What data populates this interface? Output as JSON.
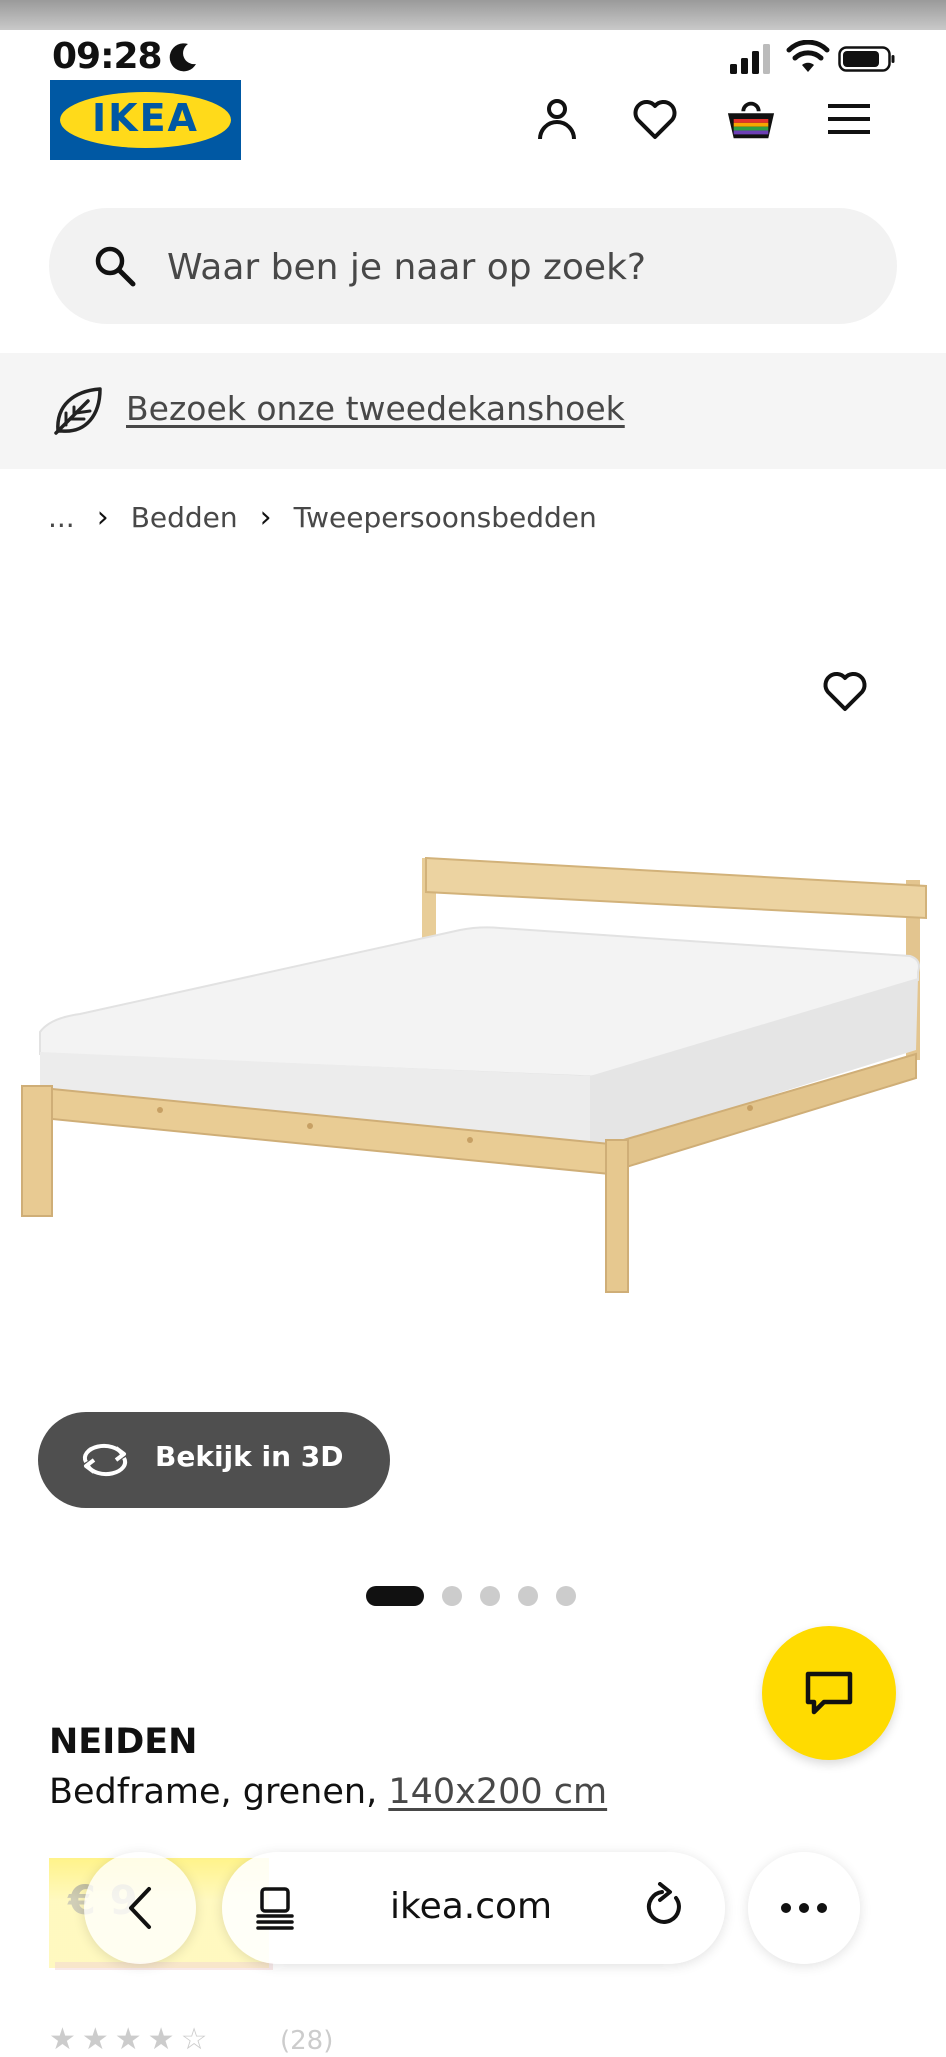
{
  "status_bar": {
    "time": "09:28"
  },
  "header": {
    "logo_text": "IKEA"
  },
  "search": {
    "placeholder": "Waar ben je naar op zoek?"
  },
  "banner": {
    "link_text": "Bezoek onze tweedekanshoek"
  },
  "breadcrumb": {
    "ellipsis": "...",
    "items": [
      "Bedden",
      "Tweepersoonsbedden"
    ]
  },
  "gallery": {
    "view_3d_label": "Bekijk in 3D",
    "dot_count": 5,
    "active_index": 0
  },
  "product": {
    "name": "NEIDEN",
    "description": "Bedframe, grenen, ",
    "size_link": "140x200 cm",
    "price_partial": "€       9",
    "rating_count": "(28)"
  },
  "browser": {
    "url": "ikea.com"
  },
  "colors": {
    "ikea_blue": "#0058a3",
    "ikea_yellow": "#ffda1a",
    "chat_yellow": "#ffdb00",
    "view3d_bg": "#4f4f4f"
  }
}
